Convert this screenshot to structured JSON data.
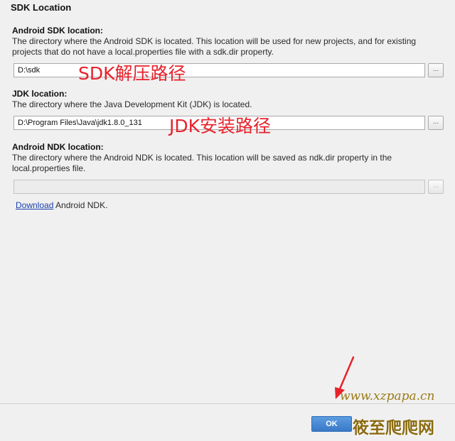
{
  "window": {
    "title": "SDK Location"
  },
  "android_sdk": {
    "title": "Android SDK location:",
    "description": "The directory where the Android SDK is located. This location will be used for new projects, and for existing projects that do not have a local.properties file with a sdk.dir property.",
    "path": "D:\\sdk",
    "browse_label": "...",
    "annotation": "SDK解压路径"
  },
  "jdk": {
    "title": "JDK location:",
    "description": "The directory where the Java Development Kit (JDK) is located.",
    "path": "D:\\Program Files\\Java\\jdk1.8.0_131",
    "browse_label": "...",
    "annotation": "JDK安装路径"
  },
  "android_ndk": {
    "title": "Android NDK location:",
    "description": "The directory where the Android NDK is located. This location will be saved as ndk.dir property in the local.properties file.",
    "path": "",
    "browse_label": "...",
    "download_link": "Download",
    "download_suffix": " Android NDK."
  },
  "footer": {
    "ok_label": "OK"
  },
  "watermark": {
    "url": "www.xzpapa.cn",
    "name": "筱至爬爬网"
  },
  "colors": {
    "annotation": "#e8222b",
    "accent": "#3a79c8",
    "link": "#1a3fae",
    "background": "#f0f0f0"
  }
}
